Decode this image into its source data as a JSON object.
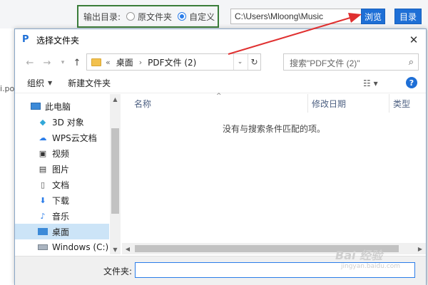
{
  "background_app": {
    "output_dir_label": "输出目录:",
    "option_original": "原文件夹",
    "option_custom": "自定义",
    "selected_option": "custom",
    "path_value": "C:\\Users\\Mloong\\Music",
    "browse_button": "浏览",
    "dir_button": "目录",
    "left_partial_text": "i.po",
    "accent_color": "#1e6fd6",
    "highlight_box_color": "#3a7d3a",
    "arrow_color": "#e03030"
  },
  "dialog": {
    "title": "选择文件夹",
    "app_icon": "P",
    "close_glyph": "✕",
    "nav": {
      "back_glyph": "←",
      "forward_glyph": "→",
      "recent_glyph": "▾",
      "up_glyph": "↑"
    },
    "address": {
      "overflow_glyph": "«",
      "crumbs": [
        "桌面",
        "PDF文件 (2)"
      ],
      "separator": "›",
      "dropdown_glyph": "⌄",
      "refresh_glyph": "↻"
    },
    "search": {
      "placeholder": "搜索\"PDF文件 (2)\"",
      "icon": "search-icon"
    },
    "commands": {
      "organize": "组织",
      "new_folder": "新建文件夹",
      "view_glyph": "☷  ▾",
      "help_glyph": "?"
    },
    "nav_pane": [
      {
        "label": "此电脑",
        "icon": "computer-icon"
      },
      {
        "label": "3D 对象",
        "icon": "cube-icon"
      },
      {
        "label": "WPS云文档",
        "icon": "cloud-icon"
      },
      {
        "label": "视频",
        "icon": "video-icon"
      },
      {
        "label": "图片",
        "icon": "picture-icon"
      },
      {
        "label": "文档",
        "icon": "document-icon"
      },
      {
        "label": "下载",
        "icon": "download-icon"
      },
      {
        "label": "音乐",
        "icon": "music-icon"
      },
      {
        "label": "桌面",
        "icon": "desktop-icon",
        "selected": true
      },
      {
        "label": "Windows (C:)",
        "icon": "drive-icon"
      }
    ],
    "columns": {
      "name": "名称",
      "modified": "修改日期",
      "type": "类型"
    },
    "empty_message": "没有与搜索条件匹配的项。",
    "footer": {
      "folder_label": "文件夹:",
      "folder_value": ""
    }
  },
  "watermark": {
    "main": "Bai 经验",
    "sub": "jingyan.baidu.com"
  }
}
